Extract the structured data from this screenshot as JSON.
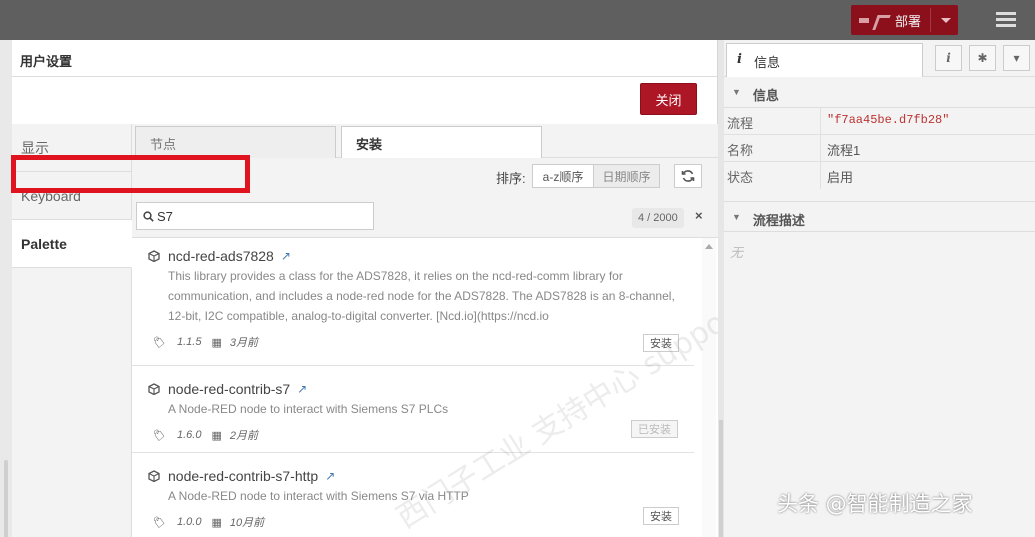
{
  "header": {
    "deploy_label": "部署"
  },
  "dialog": {
    "title": "用户设置",
    "close_label": "关闭",
    "side_tabs": [
      {
        "label": "显示"
      },
      {
        "label": "Keyboard"
      },
      {
        "label": "Palette"
      }
    ],
    "sub_tabs": [
      {
        "label": "节点"
      },
      {
        "label": "安装"
      }
    ],
    "sort": {
      "label": "排序:",
      "az": "a-z顺序",
      "date": "日期顺序"
    },
    "search": {
      "value": "S7",
      "placeholder": ""
    },
    "count": "4 / 2000",
    "clear": "×",
    "packages": [
      {
        "name": "ncd-red-ads7828",
        "desc": "This library provides a class for the ADS7828, it relies on the ncd-red-comm library for communication, and includes a node-red node for the ADS7828. The ADS7828 is an 8-channel, 12-bit, I2C compatible, analog-to-digital converter. [Ncd.io](https://ncd.io",
        "version": "1.1.5",
        "updated": "3月前",
        "action": "安装",
        "installed": false
      },
      {
        "name": "node-red-contrib-s7",
        "desc": "A Node-RED node to interact with Siemens S7 PLCs",
        "version": "1.6.0",
        "updated": "2月前",
        "action": "已安装",
        "installed": true
      },
      {
        "name": "node-red-contrib-s7-http",
        "desc": "A Node-RED node to interact with Siemens S7 via HTTP",
        "version": "1.0.0",
        "updated": "10月前",
        "action": "安装",
        "installed": false
      }
    ]
  },
  "info_panel": {
    "tab_label": "信息",
    "info_section": "信息",
    "props": [
      {
        "key": "流程",
        "value": "\"f7aa45be.d7fb28\""
      },
      {
        "key": "名称",
        "value": "流程1"
      },
      {
        "key": "状态",
        "value": "启用"
      }
    ],
    "desc_section": "流程描述",
    "desc_empty": "无"
  },
  "watermark": "西门子工业 支持中心 support.industry.siemens.com",
  "credit": "头条 @智能制造之家"
}
